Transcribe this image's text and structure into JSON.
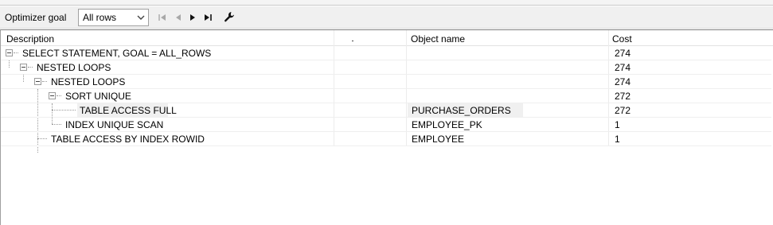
{
  "toolbar": {
    "optimizer_label": "Optimizer goal",
    "optimizer_value": "All rows"
  },
  "columns": {
    "description": "Description",
    "object_name": "Object name",
    "cost": "Cost"
  },
  "rows": [
    {
      "description": "SELECT STATEMENT, GOAL = ALL_ROWS",
      "object": "",
      "cost": "274"
    },
    {
      "description": "NESTED LOOPS",
      "object": "",
      "cost": "274"
    },
    {
      "description": "NESTED LOOPS",
      "object": "",
      "cost": "274"
    },
    {
      "description": "SORT UNIQUE",
      "object": "",
      "cost": "272"
    },
    {
      "description": "TABLE ACCESS FULL",
      "object": "PURCHASE_ORDERS",
      "cost": "272"
    },
    {
      "description": "INDEX UNIQUE SCAN",
      "object": "EMPLOYEE_PK",
      "cost": "1"
    },
    {
      "description": "TABLE ACCESS BY INDEX ROWID",
      "object": "EMPLOYEE",
      "cost": "1"
    }
  ],
  "icons": {
    "dropdown": "chevron-down-icon",
    "first": "first-record-icon",
    "previous": "previous-record-icon",
    "next": "next-record-icon",
    "last": "last-record-icon",
    "settings": "wrench-icon"
  }
}
